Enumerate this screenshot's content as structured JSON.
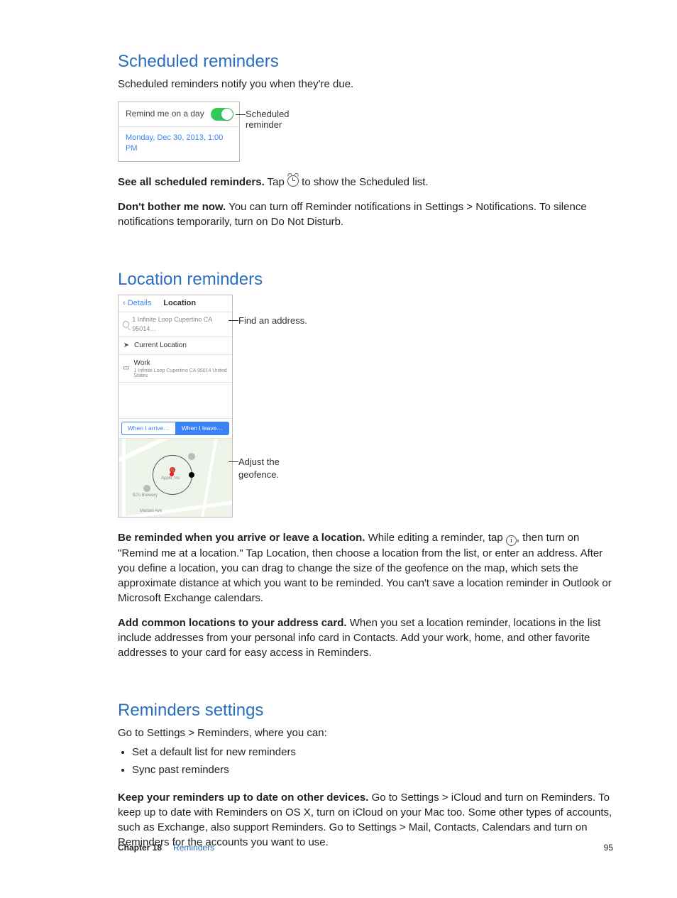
{
  "section1": {
    "heading": "Scheduled reminders",
    "lead": "Scheduled reminders notify you when they're due.",
    "fig_row1": "Remind me on a day",
    "fig_row2": "Monday, Dec 30, 2013, 1:00 PM",
    "callout_l1": "Scheduled",
    "callout_l2": "reminder",
    "p2_bold": "See all scheduled reminders.",
    "p2_rest_a": " Tap ",
    "p2_rest_b": " to show the Scheduled list.",
    "p3_bold": "Don't bother me now.",
    "p3_rest": " You can turn off Reminder notifications in Settings > Notifications. To silence notifications temporarily, turn on Do Not Disturb."
  },
  "section2": {
    "heading": "Location reminders",
    "nav_back": "Details",
    "nav_title": "Location",
    "search_text": "1 Infinite Loop Cupertino CA 95014…",
    "item_current": "Current Location",
    "item_work": "Work",
    "item_work_sub": "1 Infinite Loop Cupertino CA 95014 United States",
    "seg_arrive": "When I arrive…",
    "seg_leave": "When I leave…",
    "map_label_apple": "Apple, Inc",
    "map_label_bj": "BJ's Brewery",
    "map_label_road": "Mariani Ave",
    "callout_find": "Find an address.",
    "callout_geo_l1": "Adjust the",
    "callout_geo_l2": "geofence.",
    "p1_bold": "Be reminded when you arrive or leave a location.",
    "p1_rest_a": " While editing a reminder, tap ",
    "p1_rest_b": ", then turn on \"Remind me at a location.\" Tap Location, then choose a location from the list, or enter an address. After you define a location, you can drag to change the size of the geofence on the map, which sets the approximate distance at which you want to be reminded. You can't save a location reminder in Outlook or Microsoft Exchange calendars.",
    "p2_bold": "Add common locations to your address card.",
    "p2_rest": " When you set a location reminder, locations in the list include addresses from your personal info card in Contacts. Add your work, home, and other favorite addresses to your card for easy access in Reminders."
  },
  "section3": {
    "heading": "Reminders settings",
    "lead": "Go to Settings > Reminders, where you can:",
    "bullets": [
      "Set a default list for new reminders",
      "Sync past reminders"
    ],
    "p1_bold": "Keep your reminders up to date on other devices.",
    "p1_rest": " Go to Settings > iCloud and turn on Reminders. To keep up to date with Reminders on OS X, turn on iCloud on your Mac too. Some other types of accounts, such as Exchange, also support Reminders. Go to Settings > Mail, Contacts, Calendars and turn on Reminders for the accounts you want to use."
  },
  "footer": {
    "chapter": "Chapter  18",
    "title": "Reminders",
    "page": "95"
  }
}
